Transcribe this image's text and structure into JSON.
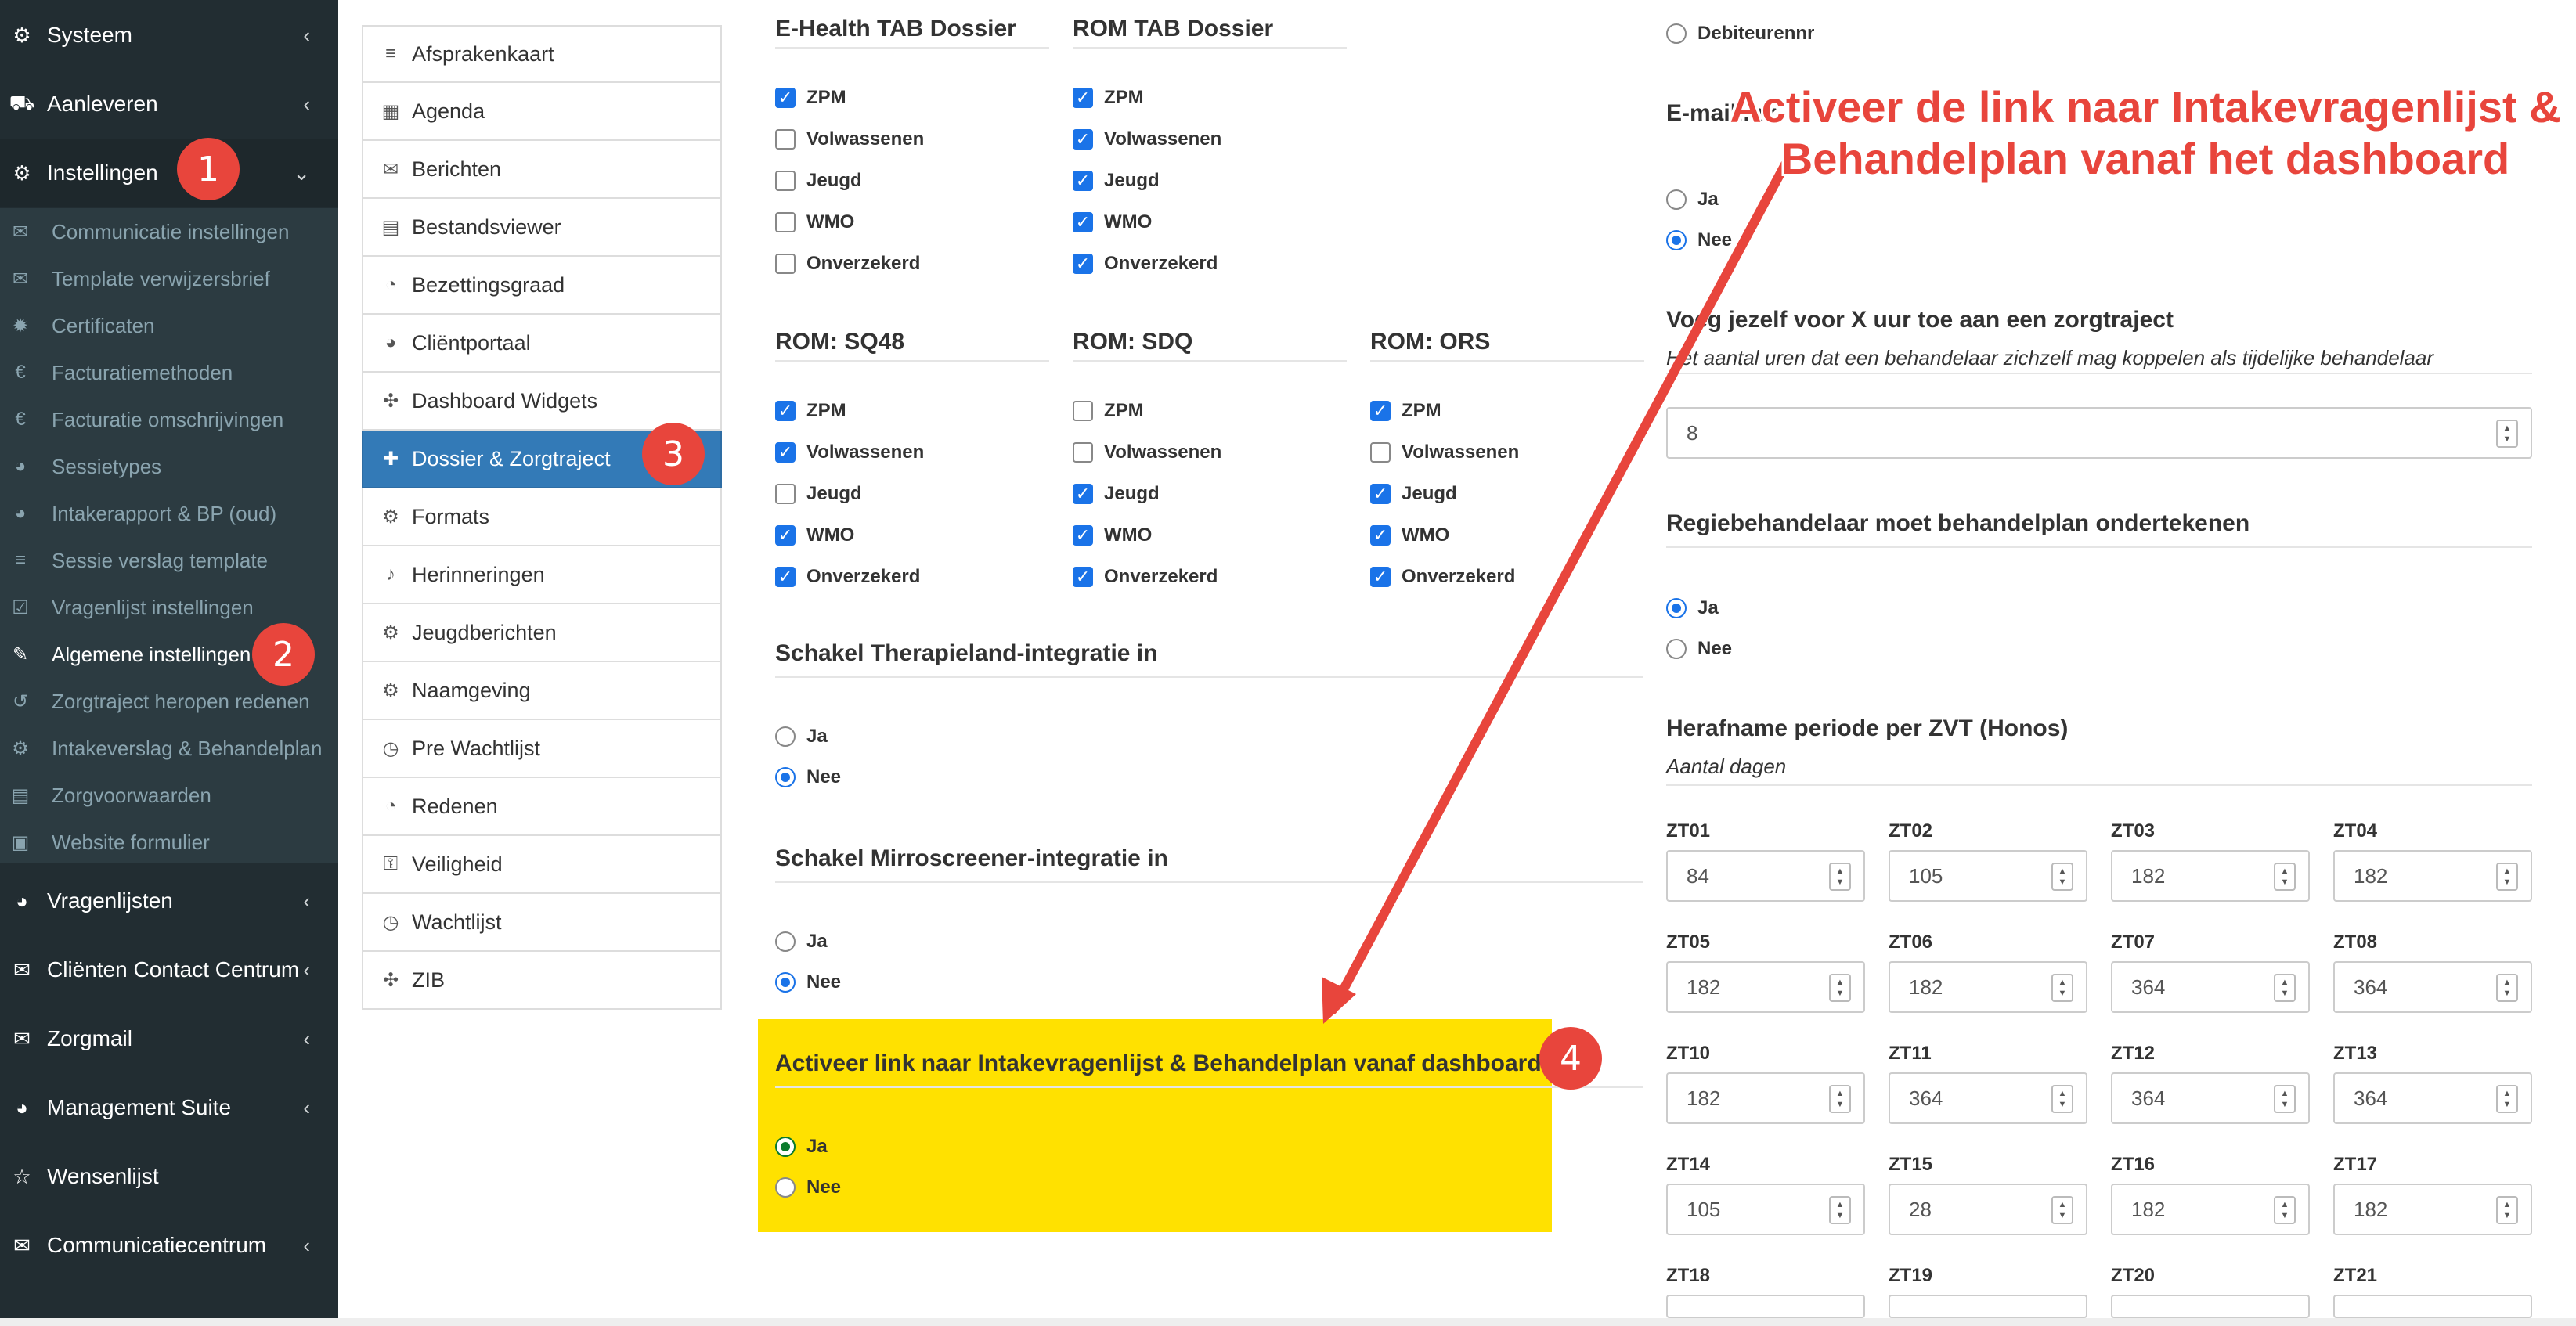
{
  "sidebar": {
    "main_items": [
      {
        "label": "Systeem",
        "icon": "cogs-icon"
      },
      {
        "label": "Aanleveren",
        "icon": "truck-icon"
      },
      {
        "label": "Instellingen",
        "icon": "gear-icon"
      },
      {
        "label": "Vragenlijsten",
        "icon": "globe-icon"
      },
      {
        "label": "Cliënten Contact Centrum",
        "icon": "envelope-icon"
      },
      {
        "label": "Zorgmail",
        "icon": "envelope-icon"
      },
      {
        "label": "Management Suite",
        "icon": "globe-icon"
      },
      {
        "label": "Wensenlijst",
        "icon": "star-icon"
      },
      {
        "label": "Communicatiecentrum",
        "icon": "envelope-icon"
      }
    ],
    "sub_items": [
      {
        "label": "Communicatie instellingen",
        "icon": "comments-icon"
      },
      {
        "label": "Template verwijzersbrief",
        "icon": "envelope-icon"
      },
      {
        "label": "Certificaten",
        "icon": "certificate-icon"
      },
      {
        "label": "Facturatiemethoden",
        "icon": "euro-icon"
      },
      {
        "label": "Facturatie omschrijvingen",
        "icon": "euro-icon"
      },
      {
        "label": "Sessietypes",
        "icon": "globe-icon"
      },
      {
        "label": "Intakerapport & BP (oud)",
        "icon": "globe-icon"
      },
      {
        "label": "Sessie verslag template",
        "icon": "list-icon"
      },
      {
        "label": "Vragenlijst instellingen",
        "icon": "checkbox-icon"
      },
      {
        "label": "Algemene instellingen",
        "icon": "wrench-icon"
      },
      {
        "label": "Zorgtraject heropen redenen",
        "icon": "undo-icon"
      },
      {
        "label": "Intakeverslag & Behandelplan",
        "icon": "gear-icon"
      },
      {
        "label": "Zorgvoorwaarden",
        "icon": "file-icon"
      },
      {
        "label": "Website formulier",
        "icon": "briefcase-icon"
      }
    ]
  },
  "settings_menu": [
    {
      "label": "Afsprakenkaart",
      "icon": "list-icon"
    },
    {
      "label": "Agenda",
      "icon": "calendar-icon"
    },
    {
      "label": "Berichten",
      "icon": "envelope-icon"
    },
    {
      "label": "Bestandsviewer",
      "icon": "file-icon"
    },
    {
      "label": "Bezettingsgraad",
      "icon": "pie-chart-icon"
    },
    {
      "label": "Cliëntportaal",
      "icon": "globe-icon"
    },
    {
      "label": "Dashboard Widgets",
      "icon": "puzzle-icon"
    },
    {
      "label": "Dossier & Zorgtraject",
      "icon": "briefcase-medical-icon"
    },
    {
      "label": "Formats",
      "icon": "gear-icon"
    },
    {
      "label": "Herinneringen",
      "icon": "bell-icon"
    },
    {
      "label": "Jeugdberichten",
      "icon": "gear-icon"
    },
    {
      "label": "Naamgeving",
      "icon": "gear-icon"
    },
    {
      "label": "Pre Wachtlijst",
      "icon": "clock-icon"
    },
    {
      "label": "Redenen",
      "icon": "pie-chart-icon"
    },
    {
      "label": "Veiligheid",
      "icon": "lock-icon"
    },
    {
      "label": "Wachtlijst",
      "icon": "clock-icon"
    },
    {
      "label": "ZIB",
      "icon": "puzzle-icon"
    }
  ],
  "checkbox_groups": [
    {
      "title": "E-Health TAB Dossier",
      "options": [
        [
          "ZPM",
          true
        ],
        [
          "Volwassenen",
          false
        ],
        [
          "Jeugd",
          false
        ],
        [
          "WMO",
          false
        ],
        [
          "Onverzekerd",
          false
        ]
      ]
    },
    {
      "title": "ROM TAB Dossier",
      "options": [
        [
          "ZPM",
          true
        ],
        [
          "Volwassenen",
          true
        ],
        [
          "Jeugd",
          true
        ],
        [
          "WMO",
          true
        ],
        [
          "Onverzekerd",
          true
        ]
      ]
    },
    {
      "title": "ROM: SQ48",
      "options": [
        [
          "ZPM",
          true
        ],
        [
          "Volwassenen",
          true
        ],
        [
          "Jeugd",
          false
        ],
        [
          "WMO",
          true
        ],
        [
          "Onverzekerd",
          true
        ]
      ]
    },
    {
      "title": "ROM: SDQ",
      "options": [
        [
          "ZPM",
          false
        ],
        [
          "Volwassenen",
          false
        ],
        [
          "Jeugd",
          true
        ],
        [
          "WMO",
          true
        ],
        [
          "Onverzekerd",
          true
        ]
      ]
    },
    {
      "title": "ROM: ORS",
      "options": [
        [
          "ZPM",
          true
        ],
        [
          "Volwassenen",
          false
        ],
        [
          "Jeugd",
          true
        ],
        [
          "WMO",
          true
        ],
        [
          "Onverzekerd",
          true
        ]
      ]
    }
  ],
  "therapieland": {
    "title": "Schakel Therapieland-integratie in",
    "ja": "Ja",
    "nee": "Nee",
    "selected": "Nee"
  },
  "mirroscreener": {
    "title": "Schakel Mirroscreener-integratie in",
    "ja": "Ja",
    "nee": "Nee",
    "selected": "Nee"
  },
  "intake_link": {
    "title": "Activeer link naar Intakevragenlijst & Behandelplan vanaf dashboard",
    "ja": "Ja",
    "nee": "Nee",
    "selected": "Ja"
  },
  "right_col": {
    "debiteur_label": "Debiteurennr",
    "emaillink_title": "E-maillink",
    "emaillink_ja": "Ja",
    "emaillink_nee": "Nee",
    "emaillink_selected": "Nee",
    "voeg_title": "Voeg jezelf voor X uur toe aan een zorgtraject",
    "voeg_sub": "Het aantal uren dat een behandelaar zichzelf mag koppelen als tijdelijke behandelaar",
    "voeg_value": "8",
    "regie_title": "Regiebehandelaar moet behandelplan ondertekenen",
    "regie_ja": "Ja",
    "regie_nee": "Nee",
    "regie_selected": "Ja",
    "herafname_title": "Herafname periode per ZVT (Honos)",
    "herafname_sub": "Aantal dagen",
    "zt_fields": [
      {
        "label": "ZT01",
        "value": "84"
      },
      {
        "label": "ZT02",
        "value": "105"
      },
      {
        "label": "ZT03",
        "value": "182"
      },
      {
        "label": "ZT04",
        "value": "182"
      },
      {
        "label": "ZT05",
        "value": "182"
      },
      {
        "label": "ZT06",
        "value": "182"
      },
      {
        "label": "ZT07",
        "value": "364"
      },
      {
        "label": "ZT08",
        "value": "364"
      },
      {
        "label": "ZT10",
        "value": "182"
      },
      {
        "label": "ZT11",
        "value": "364"
      },
      {
        "label": "ZT12",
        "value": "364"
      },
      {
        "label": "ZT13",
        "value": "364"
      },
      {
        "label": "ZT14",
        "value": "105"
      },
      {
        "label": "ZT15",
        "value": "28"
      },
      {
        "label": "ZT16",
        "value": "182"
      },
      {
        "label": "ZT17",
        "value": "182"
      },
      {
        "label": "ZT18",
        "value": ""
      },
      {
        "label": "ZT19",
        "value": ""
      },
      {
        "label": "ZT20",
        "value": ""
      },
      {
        "label": "ZT21",
        "value": ""
      }
    ]
  },
  "annotation": {
    "text": "Activeer de link naar Intakevragenlijst & Behandelplan vanaf het dashboard",
    "badges": [
      "1",
      "2",
      "3",
      "4"
    ],
    "color": "#e8453c"
  },
  "colors": {
    "sidebar_bg": "#222d32",
    "selected_menu": "#337ab7",
    "highlight": "#ffe100",
    "checkbox": "#1a73e8"
  }
}
